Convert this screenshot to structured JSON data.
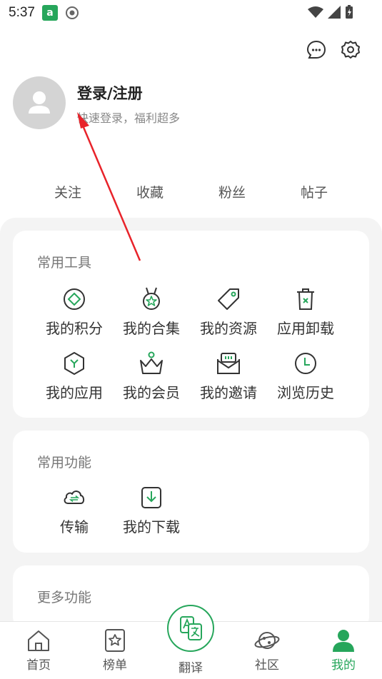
{
  "status_bar": {
    "time": "5:37",
    "app_badge": "a"
  },
  "header": {
    "login_title": "登录/注册",
    "login_subtitle": "快速登录，福利超多"
  },
  "stats": [
    "关注",
    "收藏",
    "粉丝",
    "帖子"
  ],
  "common_tools": {
    "title": "常用工具",
    "items": [
      {
        "label": "我的积分",
        "icon": "diamond-icon"
      },
      {
        "label": "我的合集",
        "icon": "medal-icon"
      },
      {
        "label": "我的资源",
        "icon": "tag-icon"
      },
      {
        "label": "应用卸载",
        "icon": "trash-icon"
      },
      {
        "label": "我的应用",
        "icon": "hexagon-icon"
      },
      {
        "label": "我的会员",
        "icon": "crown-icon"
      },
      {
        "label": "我的邀请",
        "icon": "envelope-icon"
      },
      {
        "label": "浏览历史",
        "icon": "clock-icon"
      }
    ]
  },
  "common_functions": {
    "title": "常用功能",
    "items": [
      {
        "label": "传输",
        "icon": "cloud-transfer-icon"
      },
      {
        "label": "我的下载",
        "icon": "download-icon"
      }
    ]
  },
  "more_functions": {
    "title": "更多功能"
  },
  "bottom_nav": [
    {
      "label": "首页",
      "icon": "home-icon"
    },
    {
      "label": "榜单",
      "icon": "ranking-icon"
    },
    {
      "label": "翻译",
      "icon": "translate-icon"
    },
    {
      "label": "社区",
      "icon": "planet-icon"
    },
    {
      "label": "我的",
      "icon": "profile-icon",
      "active": true
    }
  ],
  "colors": {
    "accent": "#26a65b",
    "arrow": "#e8232a"
  }
}
